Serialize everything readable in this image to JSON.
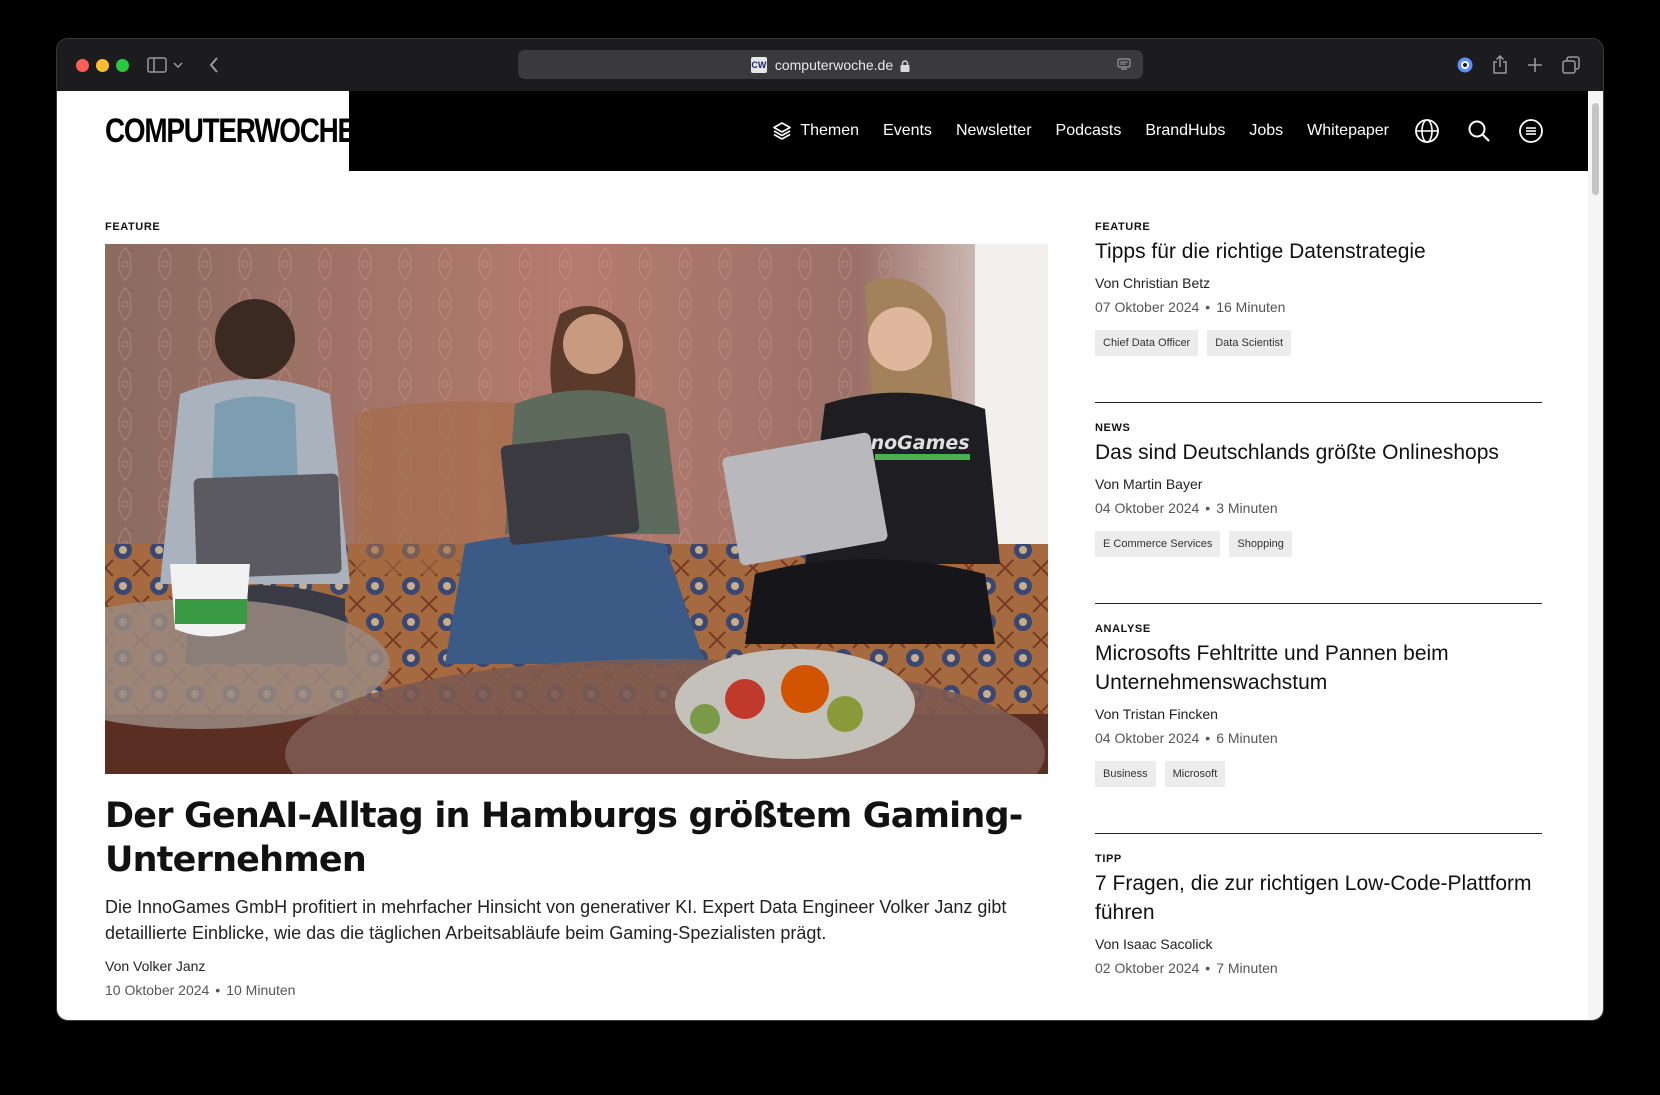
{
  "browser": {
    "url": "computerwoche.de",
    "favicon_text": "CW"
  },
  "site": {
    "logo": "COMPUTERWOCHE",
    "nav": [
      "Themen",
      "Events",
      "Newsletter",
      "Podcasts",
      "BrandHubs",
      "Jobs",
      "Whitepaper"
    ]
  },
  "main_article": {
    "kicker": "FEATURE",
    "headline": "Der GenAI-Alltag in Hamburgs größtem Gaming-Unternehmen",
    "lead": "Die InnoGames GmbH profitiert in mehrfacher Hinsicht von generativer KI. Expert Data Engineer Volker Janz gibt detaillierte Einblicke, wie das die täglichen Arbeitsabläufe beim Gaming-Spezialisten prägt.",
    "author": "Von Volker Janz",
    "date": "10 Oktober 2024",
    "read_time": "10 Minuten",
    "image_shirt_text": "InnoGames"
  },
  "side_articles": [
    {
      "kicker": "FEATURE",
      "title": "Tipps für die richtige Datenstrategie",
      "author": "Von Christian Betz",
      "date": "07 Oktober 2024",
      "read_time": "16 Minuten",
      "tags": [
        "Chief Data Officer",
        "Data Scientist"
      ]
    },
    {
      "kicker": "NEWS",
      "title": "Das sind Deutschlands größte Onlineshops",
      "author": "Von Martin Bayer",
      "date": "04 Oktober 2024",
      "read_time": "3 Minuten",
      "tags": [
        "E Commerce Services",
        "Shopping"
      ]
    },
    {
      "kicker": "ANALYSE",
      "title": "Microsofts Fehltritte und Pannen beim Unternehmenswachstum",
      "author": "Von Tristan Fincken",
      "date": "04 Oktober 2024",
      "read_time": "6 Minuten",
      "tags": [
        "Business",
        "Microsoft"
      ]
    },
    {
      "kicker": "TIPP",
      "title": "7 Fragen, die zur richtigen Low-Code-Plattform führen",
      "author": "Von Isaac Sacolick",
      "date": "02 Oktober 2024",
      "read_time": "7 Minuten",
      "tags": []
    }
  ],
  "colors": {
    "header_bg": "#000000",
    "page_bg": "#ffffff",
    "tag_bg": "#ececec"
  }
}
